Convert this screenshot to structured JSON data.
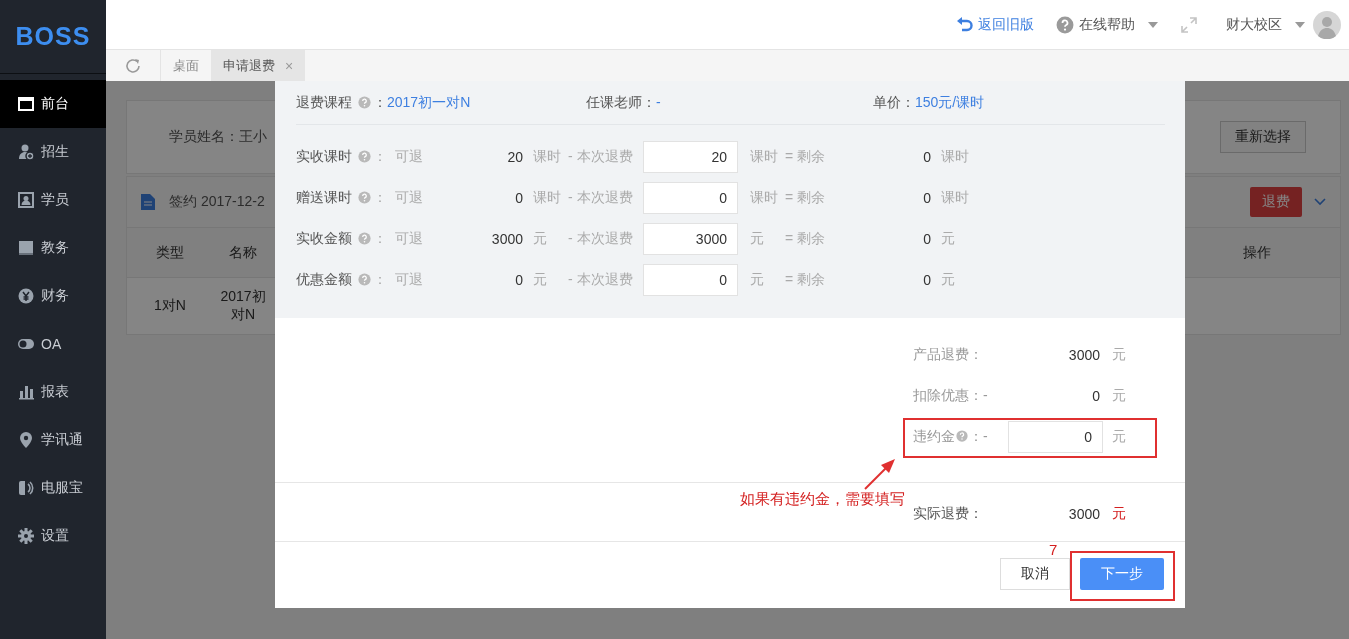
{
  "logo": "BOSS",
  "sidebar": {
    "items": [
      {
        "label": "前台",
        "selected": true
      },
      {
        "label": "招生",
        "selected": false
      },
      {
        "label": "学员",
        "selected": false
      },
      {
        "label": "教务",
        "selected": false
      },
      {
        "label": "财务",
        "selected": false
      },
      {
        "label": "OA",
        "selected": false
      },
      {
        "label": "报表",
        "selected": false
      },
      {
        "label": "学讯通",
        "selected": false
      },
      {
        "label": "电服宝",
        "selected": false
      },
      {
        "label": "设置",
        "selected": false
      }
    ]
  },
  "header": {
    "back_link": "返回旧版",
    "help": "在线帮助",
    "campus": "财大校区"
  },
  "tabs": [
    {
      "label": "桌面",
      "selected": false
    },
    {
      "label": "申请退费",
      "selected": true,
      "close": "×"
    }
  ],
  "background": {
    "student_label": "学员姓名：王小",
    "reselect": "重新选择",
    "contract": "签约 2017-12-2",
    "refund_button": "退费",
    "columns": [
      "类型",
      "名称",
      "操作"
    ],
    "row": [
      {
        "lines": [
          "1对N"
        ]
      },
      {
        "lines": [
          "2017初",
          "对N"
        ]
      }
    ]
  },
  "modal": {
    "course": {
      "label": "退费课程",
      "sep": "：",
      "value": "2017初一对N"
    },
    "teacher": {
      "label": "任课老师：",
      "value": "-"
    },
    "price": {
      "label": "单价：",
      "value": "150元/课时"
    },
    "rows": [
      {
        "label": "实收课时",
        "qualifier": "：  可退",
        "refundable": "20",
        "unit": "课时",
        "this_label": "- 本次退费",
        "value": "20",
        "unit2": "课时",
        "remain_label": "= 剩余",
        "remain": "0",
        "unit3": "课时"
      },
      {
        "label": "赠送课时",
        "qualifier": "：  可退",
        "refundable": "0",
        "unit": "课时",
        "this_label": "- 本次退费",
        "value": "0",
        "unit2": "课时",
        "remain_label": "= 剩余",
        "remain": "0",
        "unit3": "课时"
      },
      {
        "label": "实收金额",
        "qualifier": "：  可退",
        "refundable": "3000",
        "unit": "元",
        "this_label": "- 本次退费",
        "value": "3000",
        "unit2": "元",
        "remain_label": "= 剩余",
        "remain": "0",
        "unit3": "元"
      },
      {
        "label": "优惠金额",
        "qualifier": "：  可退",
        "refundable": "0",
        "unit": "元",
        "this_label": "- 本次退费",
        "value": "0",
        "unit2": "元",
        "remain_label": "= 剩余",
        "remain": "0",
        "unit3": "元"
      }
    ],
    "summary": [
      {
        "kind": "text",
        "label": "产品退费：",
        "value": "3000",
        "unit": "元"
      },
      {
        "kind": "text",
        "label": "扣除优惠：-",
        "value": "0",
        "unit": "元"
      },
      {
        "kind": "input",
        "label": "违约金",
        "sep": "：-",
        "value": "0",
        "unit": "元"
      }
    ],
    "total": {
      "label": "实际退费：",
      "value": "3000",
      "unit": "元"
    },
    "buttons": {
      "cancel": "取消",
      "next": "下一步"
    }
  },
  "annotations": {
    "note": "如果有违约金，需要填写",
    "step": "7"
  }
}
